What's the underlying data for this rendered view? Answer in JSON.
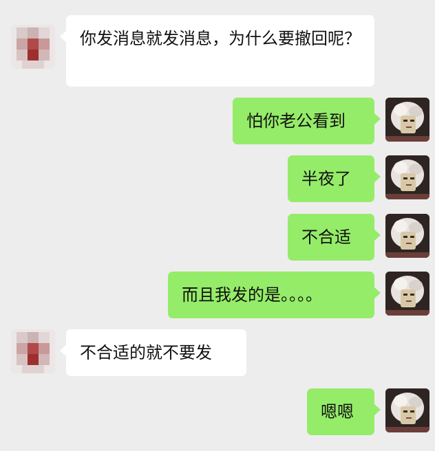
{
  "colors": {
    "background": "#ededed",
    "incoming_bubble": "#ffffff",
    "outgoing_bubble": "#95ec69",
    "text": "#111111"
  },
  "messages": [
    {
      "sender": "other",
      "text": "你发消息就发消息，为什么要撤回呢？"
    },
    {
      "sender": "self",
      "text": "怕你老公看到"
    },
    {
      "sender": "self",
      "text": "半夜了"
    },
    {
      "sender": "self",
      "text": "不合适"
    },
    {
      "sender": "self",
      "text": "而且我发的是。。。。"
    },
    {
      "sender": "other",
      "text": "不合适的就不要发"
    },
    {
      "sender": "self",
      "text": "嗯嗯"
    }
  ]
}
